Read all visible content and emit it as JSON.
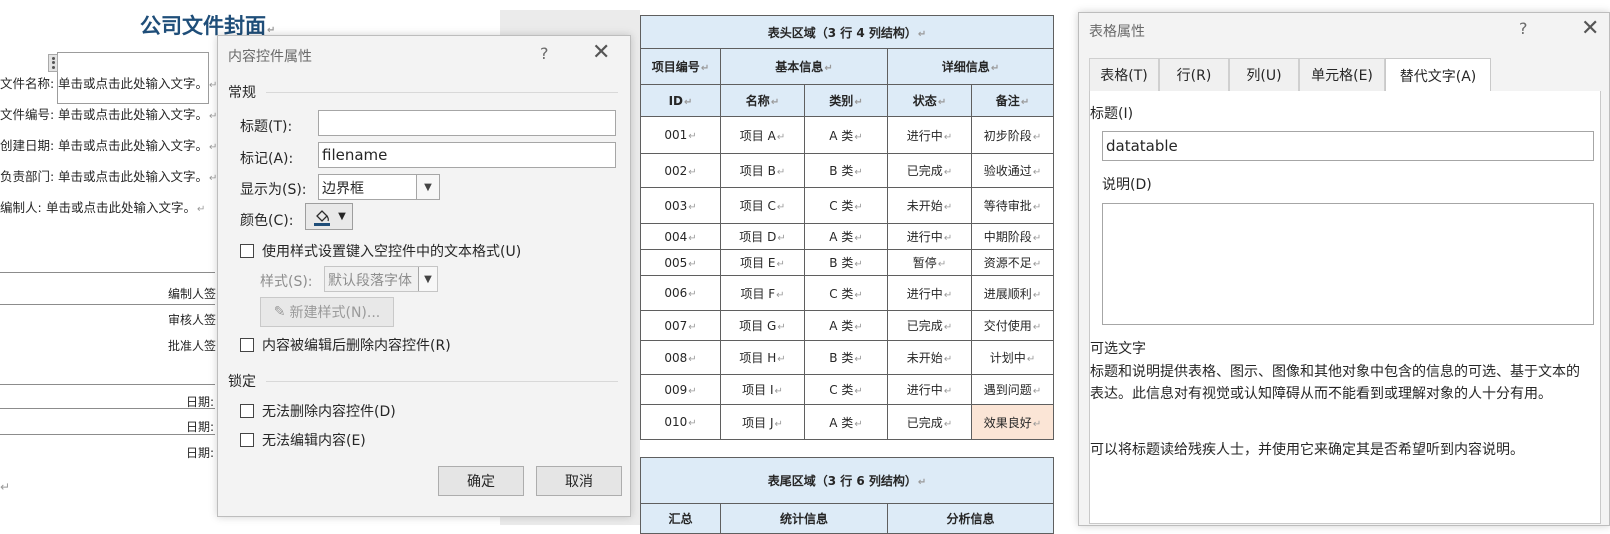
{
  "document": {
    "title": "公司文件封面",
    "return_mark": "↵",
    "fields": [
      {
        "label": "文件名称:",
        "placeholder": "单击或点击此处输入文字。"
      },
      {
        "label": "文件编号:",
        "placeholder": "单击或点击此处输入文字。"
      },
      {
        "label": "创建日期:",
        "placeholder": "单击或点击此处输入文字。"
      },
      {
        "label": "负责部门:",
        "placeholder": "单击或点击此处输入文字。"
      },
      {
        "label": "编制人:",
        "placeholder": "单击或点击此处输入文字。"
      }
    ],
    "signatures": [
      "编制人签",
      "审核人签",
      "批准人签"
    ],
    "dates": [
      "日期:",
      "日期:",
      "日期:"
    ]
  },
  "content_control_dialog": {
    "title": "内容控件属性",
    "help": "?",
    "close": "✕",
    "general_group": "常规",
    "title_label": "标题(T):",
    "title_value": "",
    "tag_label": "标记(A):",
    "tag_value": "filename",
    "show_as_label": "显示为(S):",
    "show_as_value": "边界框",
    "color_label": "颜色(C):",
    "use_style_label": "使用样式设置键入空控件中的文本格式(U)",
    "style_label": "样式(S):",
    "style_value": "默认段落字体",
    "new_style_button": "新建样式(N)...",
    "remove_after_edit_label": "内容被编辑后删除内容控件(R)",
    "lock_group": "锁定",
    "cannot_delete_label": "无法删除内容控件(D)",
    "cannot_edit_label": "无法编辑内容(E)",
    "ok_button": "确定",
    "cancel_button": "取消"
  },
  "table": {
    "header_region": "表头区域（3 行 4 列结构）",
    "group_headers": [
      "项目编号",
      "基本信息",
      "详细信息"
    ],
    "column_headers": [
      "ID",
      "名称",
      "类别",
      "状态",
      "备注"
    ],
    "rows": [
      [
        "001",
        "项目 A",
        "A 类",
        "进行中",
        "初步阶段"
      ],
      [
        "002",
        "项目 B",
        "B 类",
        "已完成",
        "验收通过"
      ],
      [
        "003",
        "项目 C",
        "C 类",
        "未开始",
        "等待审批"
      ],
      [
        "004",
        "项目 D",
        "A 类",
        "进行中",
        "中期阶段"
      ],
      [
        "005",
        "项目 E",
        "B 类",
        "暂停",
        "资源不足"
      ],
      [
        "006",
        "项目 F",
        "C 类",
        "进行中",
        "进展顺利"
      ],
      [
        "007",
        "项目 G",
        "A 类",
        "已完成",
        "交付使用"
      ],
      [
        "008",
        "项目 H",
        "B 类",
        "未开始",
        "计划中"
      ],
      [
        "009",
        "项目 I",
        "C 类",
        "进行中",
        "遇到问题"
      ],
      [
        "010",
        "项目 J",
        "A 类",
        "已完成",
        "效果良好"
      ]
    ],
    "footer_region": "表尾区域（3 行 6 列结构）",
    "footer_headers": [
      "汇总",
      "统计信息",
      "分析信息"
    ]
  },
  "table_properties_dialog": {
    "title": "表格属性",
    "help": "?",
    "close": "✕",
    "tabs": [
      "表格(T)",
      "行(R)",
      "列(U)",
      "单元格(E)",
      "替代文字(A)"
    ],
    "active_tab": "替代文字(A)",
    "title_label": "标题(I)",
    "title_value": "datatable",
    "desc_label": "说明(D)",
    "desc_value": "",
    "alt_heading": "可选文字",
    "alt_text_1": "标题和说明提供表格、图示、图像和其他对象中包含的信息的可选、基于文本的表达。此信息对有视觉或认知障碍从而不能看到或理解对象的人十分有用。",
    "alt_text_2": "可以将标题读给残疾人士，并使用它来确定其是否希望听到内容说明。"
  },
  "colors": {
    "header_fill": "#ddebf7",
    "highlight_fill": "#fbe5d6",
    "title_color": "#1f4e79",
    "dialog_bg": "#f3f3f3"
  }
}
